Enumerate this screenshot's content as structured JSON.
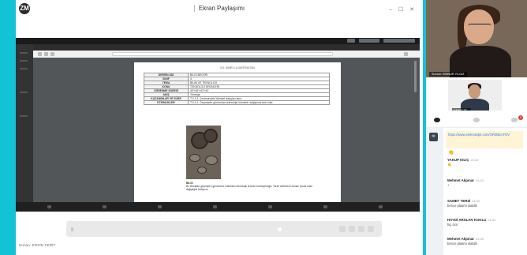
{
  "app": {
    "logo_text": "ZM"
  },
  "share": {
    "title": "Ekran Paylaşımı",
    "window_controls": "– ☐ ✕"
  },
  "document": {
    "heading": "3.5. SINIFLI 4 ÜNİTE/KONU",
    "rows": [
      {
        "key": "DERSİN ADI",
        "value": "BİLGİ BECERİ"
      },
      {
        "key": "SINIF",
        "value": "3"
      },
      {
        "key": "TEMA",
        "value": "BİLİM VE TEKNOLOJİ"
      },
      {
        "key": "KONU",
        "value": "TEKNOLOJİ ÜRÜNLERİ"
      },
      {
        "key": "ÖĞRENME SÜRESİ",
        "value": "40'+40'+40'+40'"
      },
      {
        "key": "AKIŞ",
        "value": "Yönerge"
      },
      {
        "key": "KAZANIMLAR VE SÜRE",
        "value": "T.3.2.3. Çevresindeki bilimsel buluşları tanır."
      },
      {
        "key": "ETKİNLİKLER",
        "value": "T.3.2.4. Geçmişten günümüze teknolojik ürünlerin değişimini fark eder."
      }
    ],
    "text_label": "BİLGİ",
    "text_body": "Bu etkinlikte geçmişten günümüze kullanılan teknolojik ürünleri inceleyeceğiz. Tarım aletlerinin zaman içinde nasıl değiştiğini tartışınız."
  },
  "presenter": {
    "label": "Sunan: ERSİN FERİT"
  },
  "videos": {
    "main_name": "Sunum: BİNNUR YILDIZ",
    "small_name": "SAMET TE..."
  },
  "chat": {
    "rail_button": "✉",
    "badge": "3",
    "link_text": "https://www.eteknolojik.com/OR0BEAFOV",
    "messages": [
      {
        "sender": "YAKUP KILIÇ",
        "time": "21:02",
        "body": "👏"
      },
      {
        "sender": "Mehmet Akpınar",
        "time": "21:02",
        "body": "+"
      },
      {
        "sender": "SAMET TERZİ",
        "time": "21:02",
        "body": "bence plasmi olabilir"
      },
      {
        "sender": "HAYDİ ARSLAN KOKLU",
        "time": "21:02",
        "body": "hiç ocs"
      },
      {
        "sender": "Mehmet Akpınar",
        "time": "21:02",
        "body": "bence plasmi olabilir"
      }
    ]
  },
  "colors": {
    "accent": "#12c2d6",
    "chat_highlight": "#fff4d6",
    "link": "#2a7de1"
  }
}
